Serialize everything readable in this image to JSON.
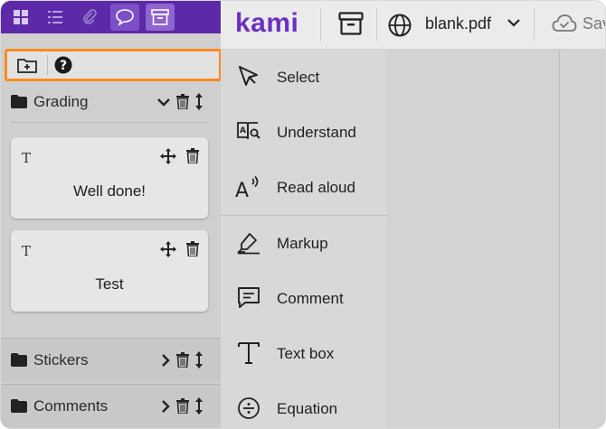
{
  "app": {
    "logo": "kami"
  },
  "sidebar": {
    "tabs": [
      "grid-icon",
      "list-icon",
      "paperclip-icon",
      "speech-bubble-icon",
      "archive-icon"
    ],
    "toolbar": {
      "buttons": [
        "add-folder-icon",
        "help-icon"
      ]
    },
    "sections": [
      {
        "title": "Grading",
        "expanded": true,
        "items": [
          {
            "type_icon": "T",
            "text": "Well done!"
          },
          {
            "type_icon": "T",
            "text": "Test"
          }
        ]
      },
      {
        "title": "Stickers",
        "expanded": false
      },
      {
        "title": "Comments",
        "expanded": false
      }
    ]
  },
  "topbar": {
    "filename": "blank.pdf",
    "save_label": "Saved"
  },
  "tools": [
    {
      "label": "Select",
      "icon": "cursor-arrow-icon"
    },
    {
      "label": "Understand",
      "icon": "dictionary-icon"
    },
    {
      "label": "Read aloud",
      "icon": "read-aloud-icon"
    },
    {
      "label": "Markup",
      "icon": "highlighter-icon"
    },
    {
      "label": "Comment",
      "icon": "comment-icon"
    },
    {
      "label": "Text box",
      "icon": "text-box-icon"
    },
    {
      "label": "Equation",
      "icon": "equation-icon"
    }
  ],
  "colors": {
    "brand": "#5c2aa8",
    "logo": "#6b2fc0",
    "focus_outline": "#ff8a1f"
  }
}
